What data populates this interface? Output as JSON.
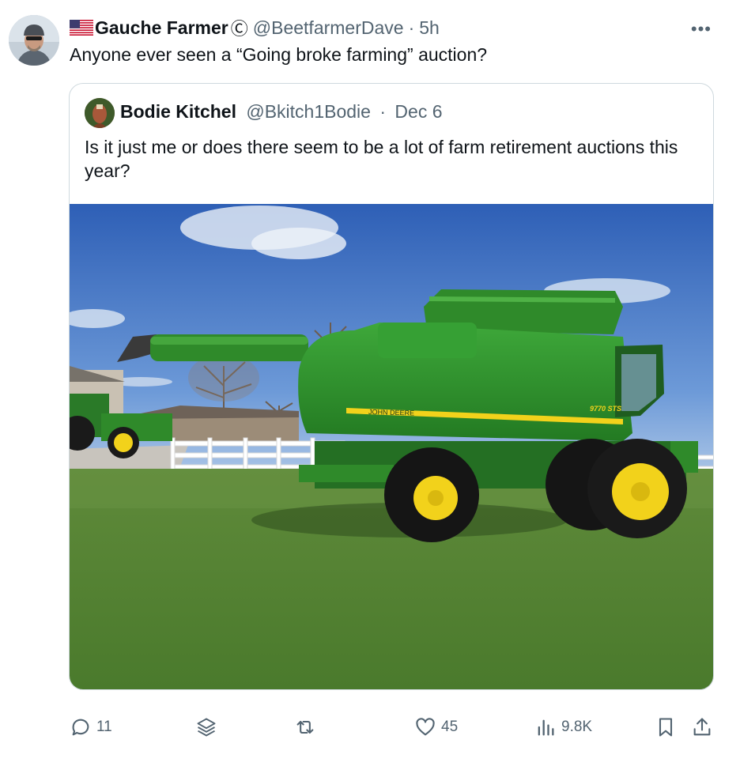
{
  "tweet": {
    "display_name": "Gauche Farmer",
    "name_badge": "Ⓒ",
    "handle": "@BeetfarmerDave",
    "separator": "·",
    "time": "5h",
    "text": "Anyone ever seen a “Going broke farming” auction?",
    "more_label": "•••",
    "avatar_icon": "user-avatar",
    "flag_icon": "us-flag-icon"
  },
  "quoted": {
    "display_name": "Bodie Kitchel",
    "handle": "@Bkitch1Bodie",
    "separator": "·",
    "time": "Dec 6",
    "text": "Is it just me or does there seem to be a lot of farm retirement auctions this year?",
    "image": {
      "brand_text": "JOHN DEERE",
      "model_text": "9770 STS"
    }
  },
  "actions": {
    "reply_count": "11",
    "retweet_count": "",
    "like_count": "45",
    "views_count": "9.8K"
  },
  "colors": {
    "text": "#0f1419",
    "muted": "#536471",
    "border": "#cfd9de",
    "deere_green": "#2f8a2a",
    "deere_yellow": "#f2d21b"
  }
}
